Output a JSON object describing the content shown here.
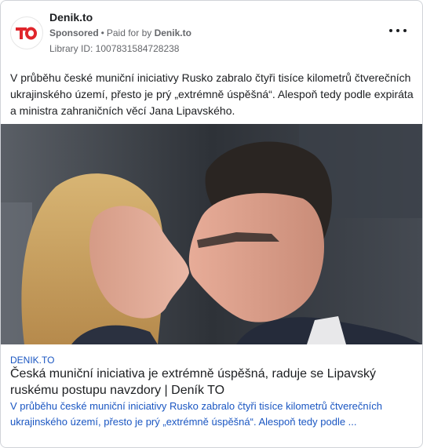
{
  "advertiser": {
    "name": "Denik.to",
    "logo_text": "TO",
    "logo_color": "#e0262c",
    "sponsored_label": "Sponsored",
    "paid_for_prefix": "Paid for by",
    "paid_for_name": "Denik.to",
    "library_id": "Library ID: 1007831584728238"
  },
  "menu": {
    "icon": "more-horizontal-icon"
  },
  "ad_text": "V průběhu české muniční iniciativy Rusko zabralo čtyři tisíce kilometrů čtverečních ukrajinského území, přesto je prý „extrémně úspěšná“. Alespoň tedy podle expiráta a ministra zahraničních věcí Jana Lipavského.",
  "link_preview": {
    "domain": "DENIK.TO",
    "title": "Česká muniční iniciativa je extrémně úspěšná, raduje se Lipavský ruskému postupu navzdory | Deník TO",
    "description": "V průběhu české muniční iniciativy Rusko zabralo čtyři tisíce kilometrů čtverečních ukrajinského území, přesto je prý „extrémně úspěšná“. Alespoň tedy podle ..."
  },
  "colors": {
    "link_blue": "#1a56c2",
    "text": "#1c1e21",
    "secondary": "#65676b"
  }
}
